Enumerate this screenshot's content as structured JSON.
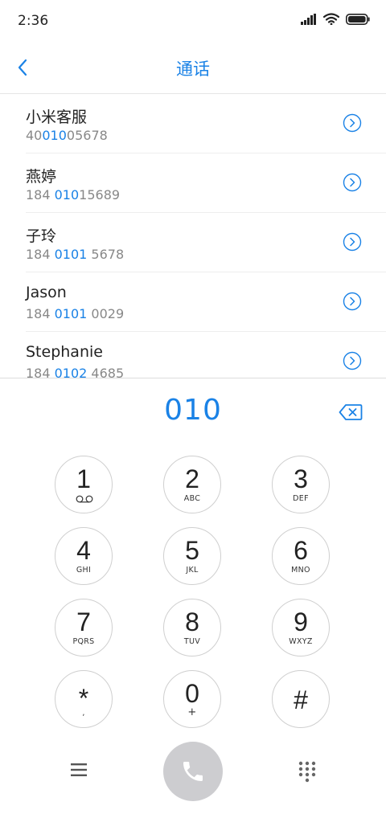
{
  "status_bar": {
    "time": "2:36"
  },
  "header": {
    "title": "通话",
    "back_icon": "chevron-left-icon"
  },
  "contacts": [
    {
      "name": "小米客服",
      "number_pre": "40",
      "number_match": "010",
      "number_post": "05678"
    },
    {
      "name": "燕婷",
      "number_pre": "184 ",
      "number_match": "010",
      "number_post": "15689"
    },
    {
      "name": "子玲",
      "number_pre": "184 ",
      "number_match": "0101",
      "number_post": " 5678"
    },
    {
      "name": "Jason",
      "number_pre": "184 ",
      "number_match": "0101",
      "number_post": " 0029"
    },
    {
      "name": "Stephanie",
      "number_pre": "184 ",
      "number_match": "0102",
      "number_post": " 4685"
    }
  ],
  "dial": {
    "entered": "010"
  },
  "keypad": [
    {
      "digit": "1",
      "letters": ""
    },
    {
      "digit": "2",
      "letters": "ABC"
    },
    {
      "digit": "3",
      "letters": "DEF"
    },
    {
      "digit": "4",
      "letters": "GHI"
    },
    {
      "digit": "5",
      "letters": "JKL"
    },
    {
      "digit": "6",
      "letters": "MNO"
    },
    {
      "digit": "7",
      "letters": "PQRS"
    },
    {
      "digit": "8",
      "letters": "TUV"
    },
    {
      "digit": "9",
      "letters": "WXYZ"
    },
    {
      "digit": "*",
      "letters": ","
    },
    {
      "digit": "0",
      "letters": "+"
    },
    {
      "digit": "#",
      "letters": ""
    }
  ],
  "colors": {
    "accent": "#1a82e6",
    "secondary_text": "#888888",
    "call_button": "#cdcdd0"
  }
}
